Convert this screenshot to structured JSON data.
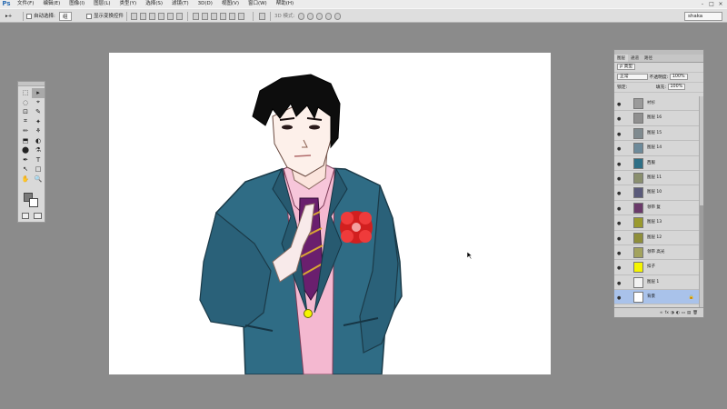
{
  "app": {
    "logo": "Ps"
  },
  "menu": [
    "文件(F)",
    "编辑(E)",
    "图像(I)",
    "图层(L)",
    "类型(Y)",
    "选择(S)",
    "滤镜(T)",
    "3D(D)",
    "视图(V)",
    "窗口(W)",
    "帮助(H)"
  ],
  "window_controls": [
    "-",
    "□",
    "×"
  ],
  "options": {
    "move_tool": "▸+",
    "auto_select_label": "自动选择:",
    "auto_select_value": "组",
    "show_transform_label": "显示变换控件",
    "mode_label": "3D 模式:",
    "workspace": "shaka"
  },
  "tools": [
    "⬚",
    "▸",
    "◌",
    "⌖",
    "⊡",
    "✎",
    "⌗",
    "✦",
    "✏",
    "⚘",
    "⬒",
    "◐",
    "⬤",
    "⚗",
    "✒",
    "T",
    "↖",
    "□",
    "✋",
    "🔍"
  ],
  "layers_panel": {
    "tabs": [
      "图层",
      "通道",
      "路径"
    ],
    "filter_label": "ρ 类型",
    "blend_mode": "正常",
    "opacity_label": "不透明度:",
    "opacity_value": "100%",
    "lock_label": "锁定:",
    "fill_label": "填充:",
    "fill_value": "100%",
    "layers": [
      {
        "name": "衬衫",
        "selected": false,
        "thumb": "#9a9a9a"
      },
      {
        "name": "图层 16",
        "selected": false,
        "thumb": "#8f8f8f"
      },
      {
        "name": "图层 15",
        "selected": false,
        "thumb": "#7f8a8f"
      },
      {
        "name": "图层 14",
        "selected": false,
        "thumb": "#6d8a9a"
      },
      {
        "name": "西服",
        "selected": false,
        "thumb": "#2e6f86"
      },
      {
        "name": "图层 11",
        "selected": false,
        "thumb": "#8a8f6e"
      },
      {
        "name": "图层 10",
        "selected": false,
        "thumb": "#5a5a7a"
      },
      {
        "name": "领带 复",
        "selected": false,
        "thumb": "#6a3a6a"
      },
      {
        "name": "图层 13",
        "selected": false,
        "thumb": "#9a9a2e"
      },
      {
        "name": "图层 12",
        "selected": false,
        "thumb": "#8e8e3a"
      },
      {
        "name": "领带 高光",
        "selected": false,
        "thumb": "#a3a35e"
      },
      {
        "name": "扣子",
        "selected": false,
        "thumb": "#f5f500"
      },
      {
        "name": "图层 1",
        "selected": false,
        "thumb": "#f2f2f2"
      },
      {
        "name": "背景",
        "selected": true,
        "thumb": "#ffffff"
      }
    ],
    "bottom_icons": [
      "∞",
      "fx",
      "◑",
      "◐",
      "▭",
      "▤",
      "🗑"
    ]
  },
  "colors": {
    "suit": "#2f6c85",
    "shirt": "#f4b8d0",
    "tie": "#6a1f6e",
    "flower": "#e02a2a",
    "button": "#f5f500"
  }
}
